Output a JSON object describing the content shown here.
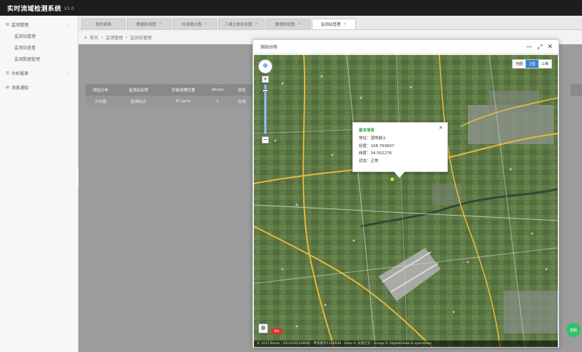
{
  "app": {
    "title": "实时流域检测系统",
    "version": "V1.0"
  },
  "sidebar": {
    "groups": [
      {
        "label": "监测管理",
        "items": [
          "监测站管理",
          "监测站查看",
          "监测数据管理"
        ]
      },
      {
        "label": "分析报表",
        "items": []
      },
      {
        "label": "消息通知",
        "items": []
      }
    ]
  },
  "tabs": [
    {
      "label": "我的桌面",
      "active": false
    },
    {
      "label": "数据折线图",
      "active": false
    },
    {
      "label": "柱状统计图",
      "active": false
    },
    {
      "label": "三维立体柱状图",
      "active": false
    },
    {
      "label": "数据饼状图",
      "active": false
    },
    {
      "label": "监测站管理",
      "active": true
    }
  ],
  "breadcrumb": {
    "home": "首页",
    "level1": "监测管理",
    "level2": "监测站管理"
  },
  "table": {
    "headers": [
      "测站分布",
      "监测站名称",
      "安装地理位置",
      "ebuye",
      "状态"
    ],
    "row": [
      "分布图",
      "监测站点",
      "El Lpha",
      "1",
      "在线"
    ]
  },
  "dialog": {
    "title": "测站分布",
    "controls": {
      "minimize": "—",
      "maximize": "⤢",
      "close": "✕"
    }
  },
  "map": {
    "types": [
      {
        "label": "地图",
        "selected": false
      },
      {
        "label": "卫星",
        "selected": true
      },
      {
        "label": "三维",
        "selected": false
      }
    ],
    "info": {
      "title": "基本信息",
      "address": "地址：湿地城上",
      "lng": "经度：108.763607",
      "lat": "纬度：34.502276",
      "status": "状态：正常"
    },
    "logo": "Bai",
    "copyright": "© 2017 Baidu - GS(2016)2089号 - 甲测资字1100930 - Data © 长地万方 - Image © DigitalGlobe & spacetime"
  },
  "colors": {
    "topbar": "#1d1d1d",
    "accent": "#3b82c4",
    "status_green": "#2f9c43",
    "overlay_grey": "#9c9c9c"
  },
  "float_button": "客服"
}
